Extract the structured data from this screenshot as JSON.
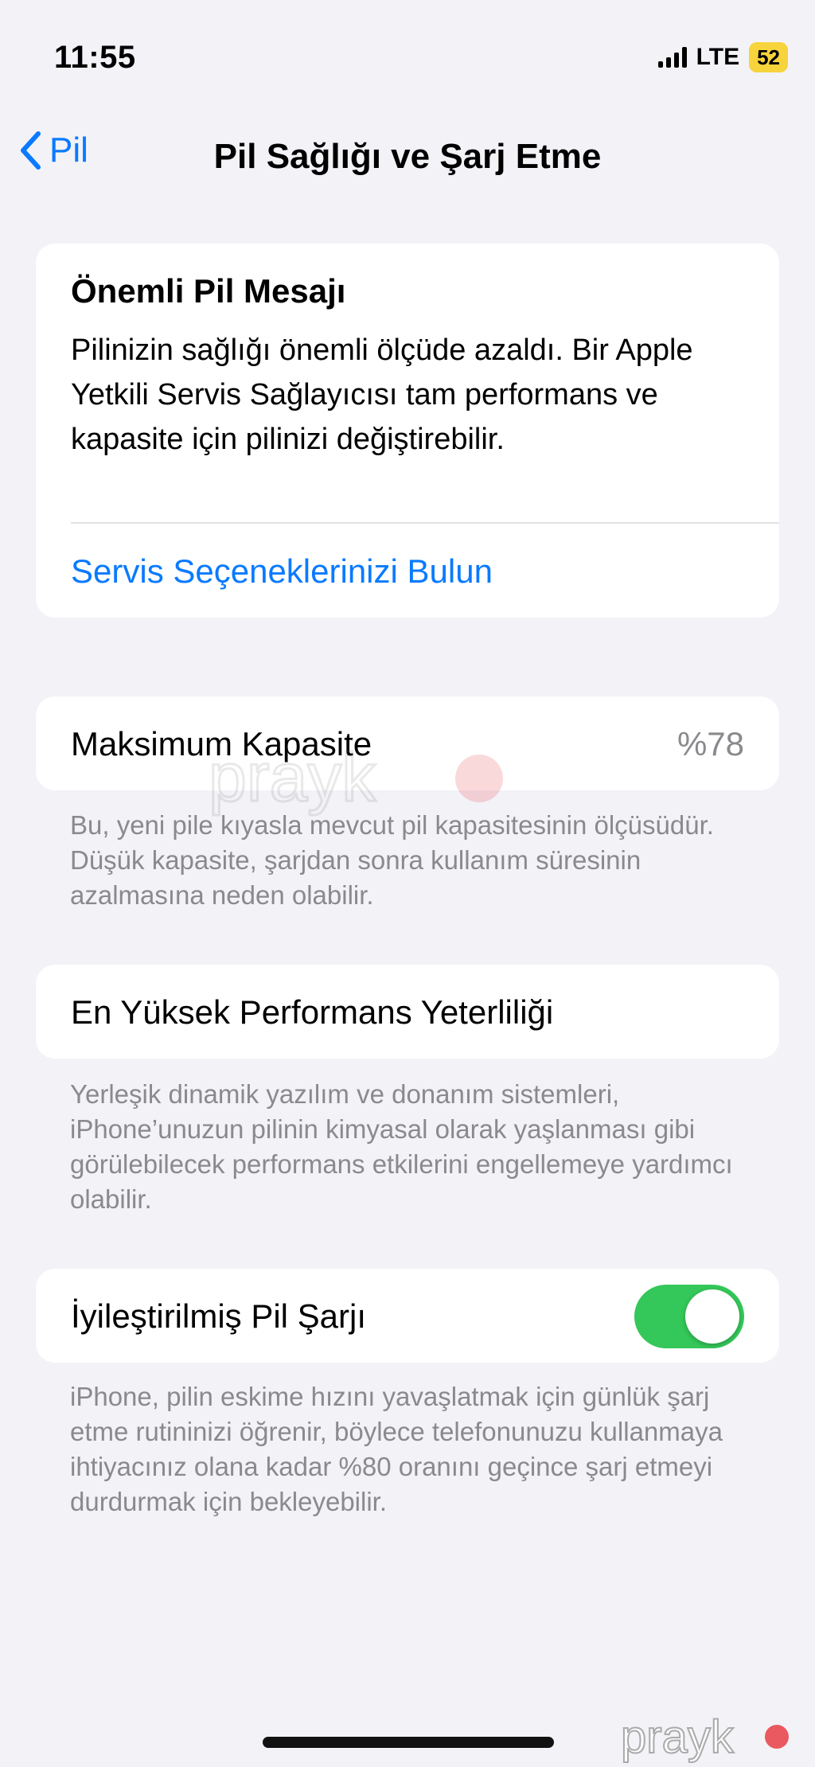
{
  "status_bar": {
    "time": "11:55",
    "network": "LTE",
    "battery": "52"
  },
  "nav": {
    "back_label": "Pil",
    "title": "Pil Sağlığı ve Şarj Etme"
  },
  "important_message": {
    "heading": "Önemli Pil Mesajı",
    "body": "Pilinizin sağlığı önemli ölçüde azaldı. Bir Apple Yetkili Servis Sağlayıcısı tam performans ve kapasite için pilinizi değiştirebilir.",
    "link": "Servis Seçeneklerinizi Bulun"
  },
  "max_capacity": {
    "label": "Maksimum Kapasite",
    "value": "%78",
    "footer": "Bu, yeni pile kıyasla mevcut pil kapasitesinin ölçüsüdür. Düşük kapasite, şarjdan sonra kullanım süresinin azalmasına neden olabilir."
  },
  "peak_performance": {
    "label": "En Yüksek Performans Yeterliliği",
    "footer": "Yerleşik dinamik yazılım ve donanım sistemleri, iPhone’unuzun pilinin kimyasal olarak yaşlanması gibi görülebilecek performans etkilerini engellemeye yardımcı olabilir."
  },
  "optimized_charging": {
    "label": "İyileştirilmiş Pil Şarjı",
    "enabled": true,
    "footer": "iPhone, pilin eskime hızını yavaşlatmak için günlük şarj etme rutininizi öğrenir, böylece telefonunuzu kullanmaya ihtiyacınız olana kadar %80 oranını geçince şarj etmeyi durdurmak için bekleyebilir."
  },
  "colors": {
    "accent": "#0a7aff",
    "toggle_on": "#34c759",
    "battery_badge": "#f7d33c",
    "watermark_dot": "#e8333a"
  },
  "watermark": {
    "text": "prayk"
  }
}
